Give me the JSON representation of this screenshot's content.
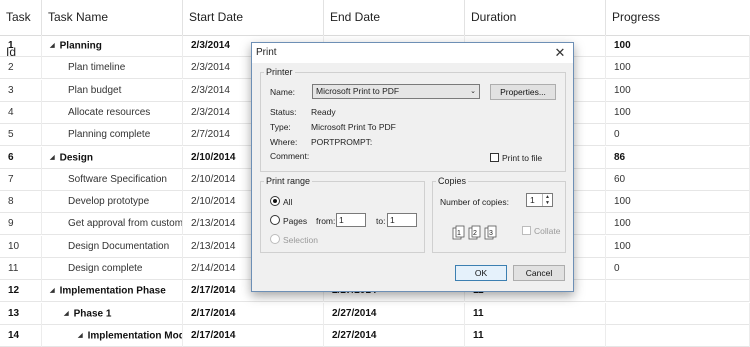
{
  "grid": {
    "columns": [
      "Task Id",
      "Task Name",
      "Start Date",
      "End Date",
      "Duration",
      "Progress"
    ],
    "rows": [
      {
        "id": "1",
        "name": "Planning",
        "start": "2/3/2014",
        "end": "",
        "duration": "",
        "progress": "100",
        "bold": true,
        "expand": true,
        "indent": 0
      },
      {
        "id": "2",
        "name": "Plan timeline",
        "start": "2/3/2014",
        "end": "",
        "duration": "",
        "progress": "100",
        "bold": false,
        "expand": false,
        "indent": 1
      },
      {
        "id": "3",
        "name": "Plan budget",
        "start": "2/3/2014",
        "end": "",
        "duration": "",
        "progress": "100",
        "bold": false,
        "expand": false,
        "indent": 1
      },
      {
        "id": "4",
        "name": "Allocate resources",
        "start": "2/3/2014",
        "end": "",
        "duration": "",
        "progress": "100",
        "bold": false,
        "expand": false,
        "indent": 1
      },
      {
        "id": "5",
        "name": "Planning complete",
        "start": "2/7/2014",
        "end": "",
        "duration": "",
        "progress": "0",
        "bold": false,
        "expand": false,
        "indent": 1
      },
      {
        "id": "6",
        "name": "Design",
        "start": "2/10/2014",
        "end": "",
        "duration": "",
        "progress": "86",
        "bold": true,
        "expand": true,
        "indent": 0
      },
      {
        "id": "7",
        "name": "Software Specification",
        "start": "2/10/2014",
        "end": "",
        "duration": "",
        "progress": "60",
        "bold": false,
        "expand": false,
        "indent": 1
      },
      {
        "id": "8",
        "name": "Develop prototype",
        "start": "2/10/2014",
        "end": "",
        "duration": "",
        "progress": "100",
        "bold": false,
        "expand": false,
        "indent": 1
      },
      {
        "id": "9",
        "name": "Get approval from custome",
        "start": "2/13/2014",
        "end": "",
        "duration": "",
        "progress": "100",
        "bold": false,
        "expand": false,
        "indent": 1
      },
      {
        "id": "10",
        "name": "Design Documentation",
        "start": "2/13/2014",
        "end": "",
        "duration": "",
        "progress": "100",
        "bold": false,
        "expand": false,
        "indent": 1
      },
      {
        "id": "11",
        "name": "Design complete",
        "start": "2/14/2014",
        "end": "",
        "duration": "",
        "progress": "0",
        "bold": false,
        "expand": false,
        "indent": 1
      },
      {
        "id": "12",
        "name": "Implementation Phase",
        "start": "2/17/2014",
        "end": "2/27/2014",
        "duration": "11",
        "progress": "",
        "bold": true,
        "expand": true,
        "indent": 0
      },
      {
        "id": "13",
        "name": "Phase 1",
        "start": "2/17/2014",
        "end": "2/27/2014",
        "duration": "11",
        "progress": "",
        "bold": true,
        "expand": true,
        "indent": 1
      },
      {
        "id": "14",
        "name": "Implementation Modul",
        "start": "2/17/2014",
        "end": "2/27/2014",
        "duration": "11",
        "progress": "",
        "bold": true,
        "expand": true,
        "indent": 2
      }
    ]
  },
  "dialog": {
    "title": "Print",
    "close_glyph": "✕",
    "printer": {
      "group_label": "Printer",
      "name_label": "Name:",
      "name_value": "Microsoft Print to PDF",
      "properties_label": "Properties...",
      "status_label": "Status:",
      "status_value": "Ready",
      "type_label": "Type:",
      "type_value": "Microsoft Print To PDF",
      "where_label": "Where:",
      "where_value": "PORTPROMPT:",
      "comment_label": "Comment:",
      "print_to_file_label": "Print to file"
    },
    "range": {
      "group_label": "Print range",
      "all_label": "All",
      "pages_label": "Pages",
      "from_label": "from:",
      "from_value": "1",
      "to_label": "to:",
      "to_value": "1",
      "selection_label": "Selection"
    },
    "copies": {
      "group_label": "Copies",
      "number_label": "Number of copies:",
      "number_value": "1",
      "collate_label": "Collate"
    },
    "ok_label": "OK",
    "cancel_label": "Cancel"
  }
}
